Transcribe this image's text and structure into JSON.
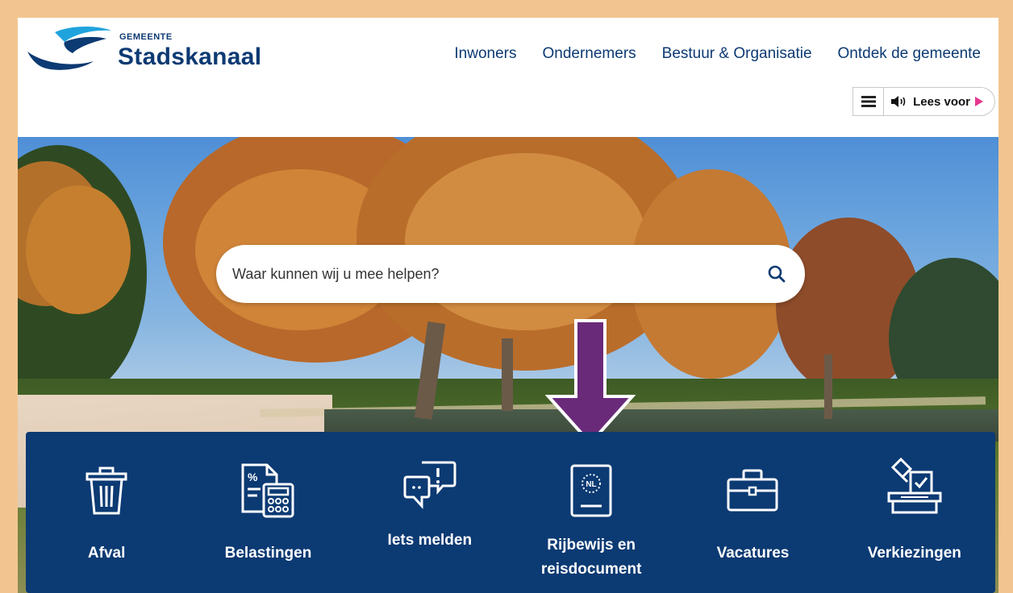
{
  "logo": {
    "small": "GEMEENTE",
    "big": "Stadskanaal"
  },
  "nav": [
    {
      "label": "Inwoners"
    },
    {
      "label": "Ondernemers"
    },
    {
      "label": "Bestuur & Organisatie"
    },
    {
      "label": "Ontdek de gemeente"
    }
  ],
  "readbar": {
    "label": "Lees voor",
    "menu_icon": "hamburger-icon",
    "speaker_icon": "speaker-icon",
    "play_icon": "play-icon"
  },
  "search": {
    "placeholder": "Waar kunnen wij u mee helpen?",
    "icon": "search-icon"
  },
  "tiles": [
    {
      "label": "Afval",
      "icon": "trash-icon"
    },
    {
      "label": "Belastingen",
      "icon": "tax-calculator-icon"
    },
    {
      "label": "Iets melden",
      "icon": "chat-alert-icon"
    },
    {
      "label": "Rijbewijs en",
      "label2": "reisdocument",
      "icon": "passport-icon",
      "icon_text": "NL"
    },
    {
      "label": "Vacatures",
      "icon": "briefcase-icon"
    },
    {
      "label": "Verkiezingen",
      "icon": "ballot-box-icon"
    }
  ],
  "colors": {
    "brand": "#0c3a73",
    "frame": "#f2c590",
    "arrow": "#6a2a7a",
    "play": "#e8368f"
  }
}
